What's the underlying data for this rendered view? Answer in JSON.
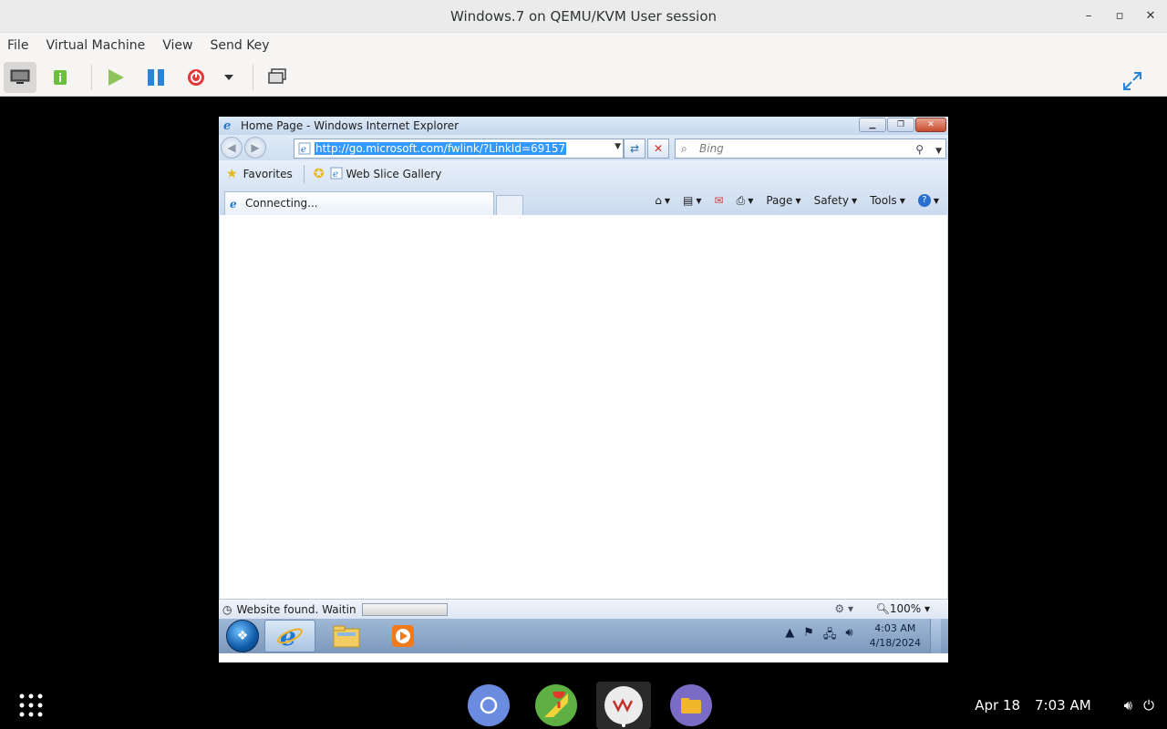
{
  "host": {
    "window_title": "Windows.7 on QEMU/KVM User session",
    "menu": [
      "File",
      "Virtual Machine",
      "View",
      "Send Key"
    ],
    "wm": {
      "minimize": "–",
      "maximize": "▫",
      "close": "✕"
    }
  },
  "ie": {
    "title": "Home Page - Windows Internet Explorer",
    "url": "http://go.microsoft.com/fwlink/?LinkId=69157",
    "search_placeholder": "Bing",
    "favorites_label": "Favorites",
    "web_slice_label": "Web Slice Gallery",
    "tab_label": "Connecting...",
    "commands": [
      "Page",
      "Safety",
      "Tools"
    ],
    "status_text": "Website found. Waitin",
    "zoom": "100%"
  },
  "w7": {
    "clock_time": "4:03 AM",
    "clock_date": "4/18/2024"
  },
  "dock": {
    "date": "Apr 18",
    "time": "7:03 AM"
  },
  "colors": {
    "selection": "#3399ff",
    "host_bg": "#f6f5f4",
    "desktop_bg": "#000000"
  }
}
